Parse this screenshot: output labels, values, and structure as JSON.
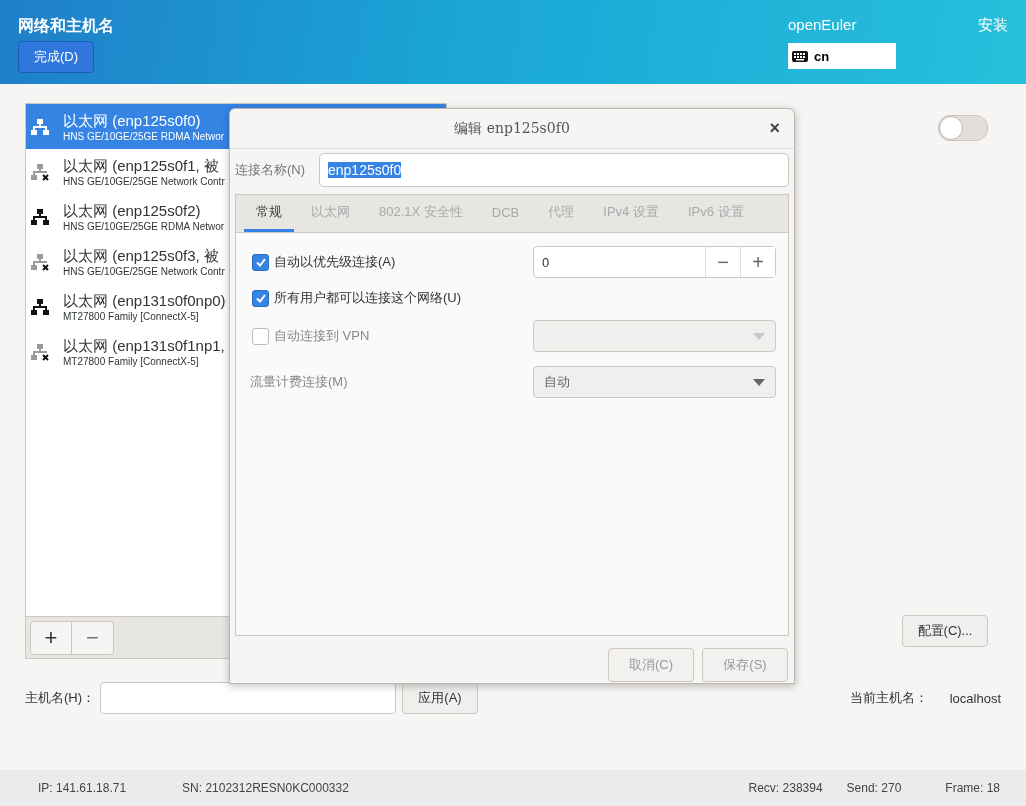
{
  "header": {
    "title": "网络和主机名",
    "done_button": "完成(D)",
    "product": "openEuler",
    "install_label": "安装",
    "keyboard_layout": "cn"
  },
  "interfaces": [
    {
      "title": "以太网 (enp125s0f0)",
      "subtitle": "HNS GE/10GE/25GE RDMA Networ",
      "connected": true,
      "selected": true
    },
    {
      "title": "以太网 (enp125s0f1, 被",
      "subtitle": "HNS GE/10GE/25GE Network Contr",
      "connected": false,
      "selected": false
    },
    {
      "title": "以太网 (enp125s0f2)",
      "subtitle": "HNS GE/10GE/25GE RDMA Networ",
      "connected": true,
      "selected": false
    },
    {
      "title": "以太网 (enp125s0f3, 被",
      "subtitle": "HNS GE/10GE/25GE Network Contr",
      "connected": false,
      "selected": false
    },
    {
      "title": "以太网 (enp131s0f0np0)",
      "subtitle": "MT27800 Family [ConnectX-5]",
      "connected": true,
      "selected": false
    },
    {
      "title": "以太网 (enp131s0f1np1,",
      "subtitle": "MT27800 Family [ConnectX-5]",
      "connected": false,
      "selected": false
    }
  ],
  "list_buttons": [
    "+",
    "−"
  ],
  "device_switch": {
    "on": false
  },
  "configure_button": "配置(C)...",
  "hostname": {
    "label": "主机名(H)：",
    "apply_button": "应用(A)",
    "current_label": "当前主机名：",
    "current_value": "localhost"
  },
  "dialog": {
    "title": "编辑 enp125s0f0",
    "close": "×",
    "name_label": "连接名称(N)",
    "name_value": "enp125s0f0",
    "tabs": [
      {
        "label": "常规",
        "selected": true
      },
      {
        "label": "以太网",
        "selected": false
      },
      {
        "label": "802.1X 安全性",
        "selected": false
      },
      {
        "label": "DCB",
        "selected": false
      },
      {
        "label": "代理",
        "selected": false
      },
      {
        "label": "IPv4 设置",
        "selected": false
      },
      {
        "label": "IPv6 设置",
        "selected": false
      }
    ],
    "options": [
      {
        "kind": "check-spin",
        "label": "自动以优先级连接(A)",
        "checked": true,
        "disabled": false,
        "value": "0",
        "minus": "−",
        "plus": "+"
      },
      {
        "kind": "check",
        "label": "所有用户都可以连接这个网络(U)",
        "checked": true,
        "disabled": false
      },
      {
        "kind": "check-combo",
        "label": "自动连接到 VPN",
        "checked": false,
        "disabled": true
      },
      {
        "kind": "label-combo",
        "label": "流量计费连接(M)",
        "disabled": true,
        "value": "自动"
      }
    ],
    "buttons": [
      {
        "label": "取消(C)",
        "disabled": true
      },
      {
        "label": "保存(S)",
        "disabled": true
      }
    ]
  },
  "status_bar": {
    "ip": "IP: 141.61.18.71",
    "sn": "SN: 2102312RESN0KC000332",
    "recv": "Recv: 238394",
    "send": "Send: 270",
    "frame": "Frame: 18"
  }
}
